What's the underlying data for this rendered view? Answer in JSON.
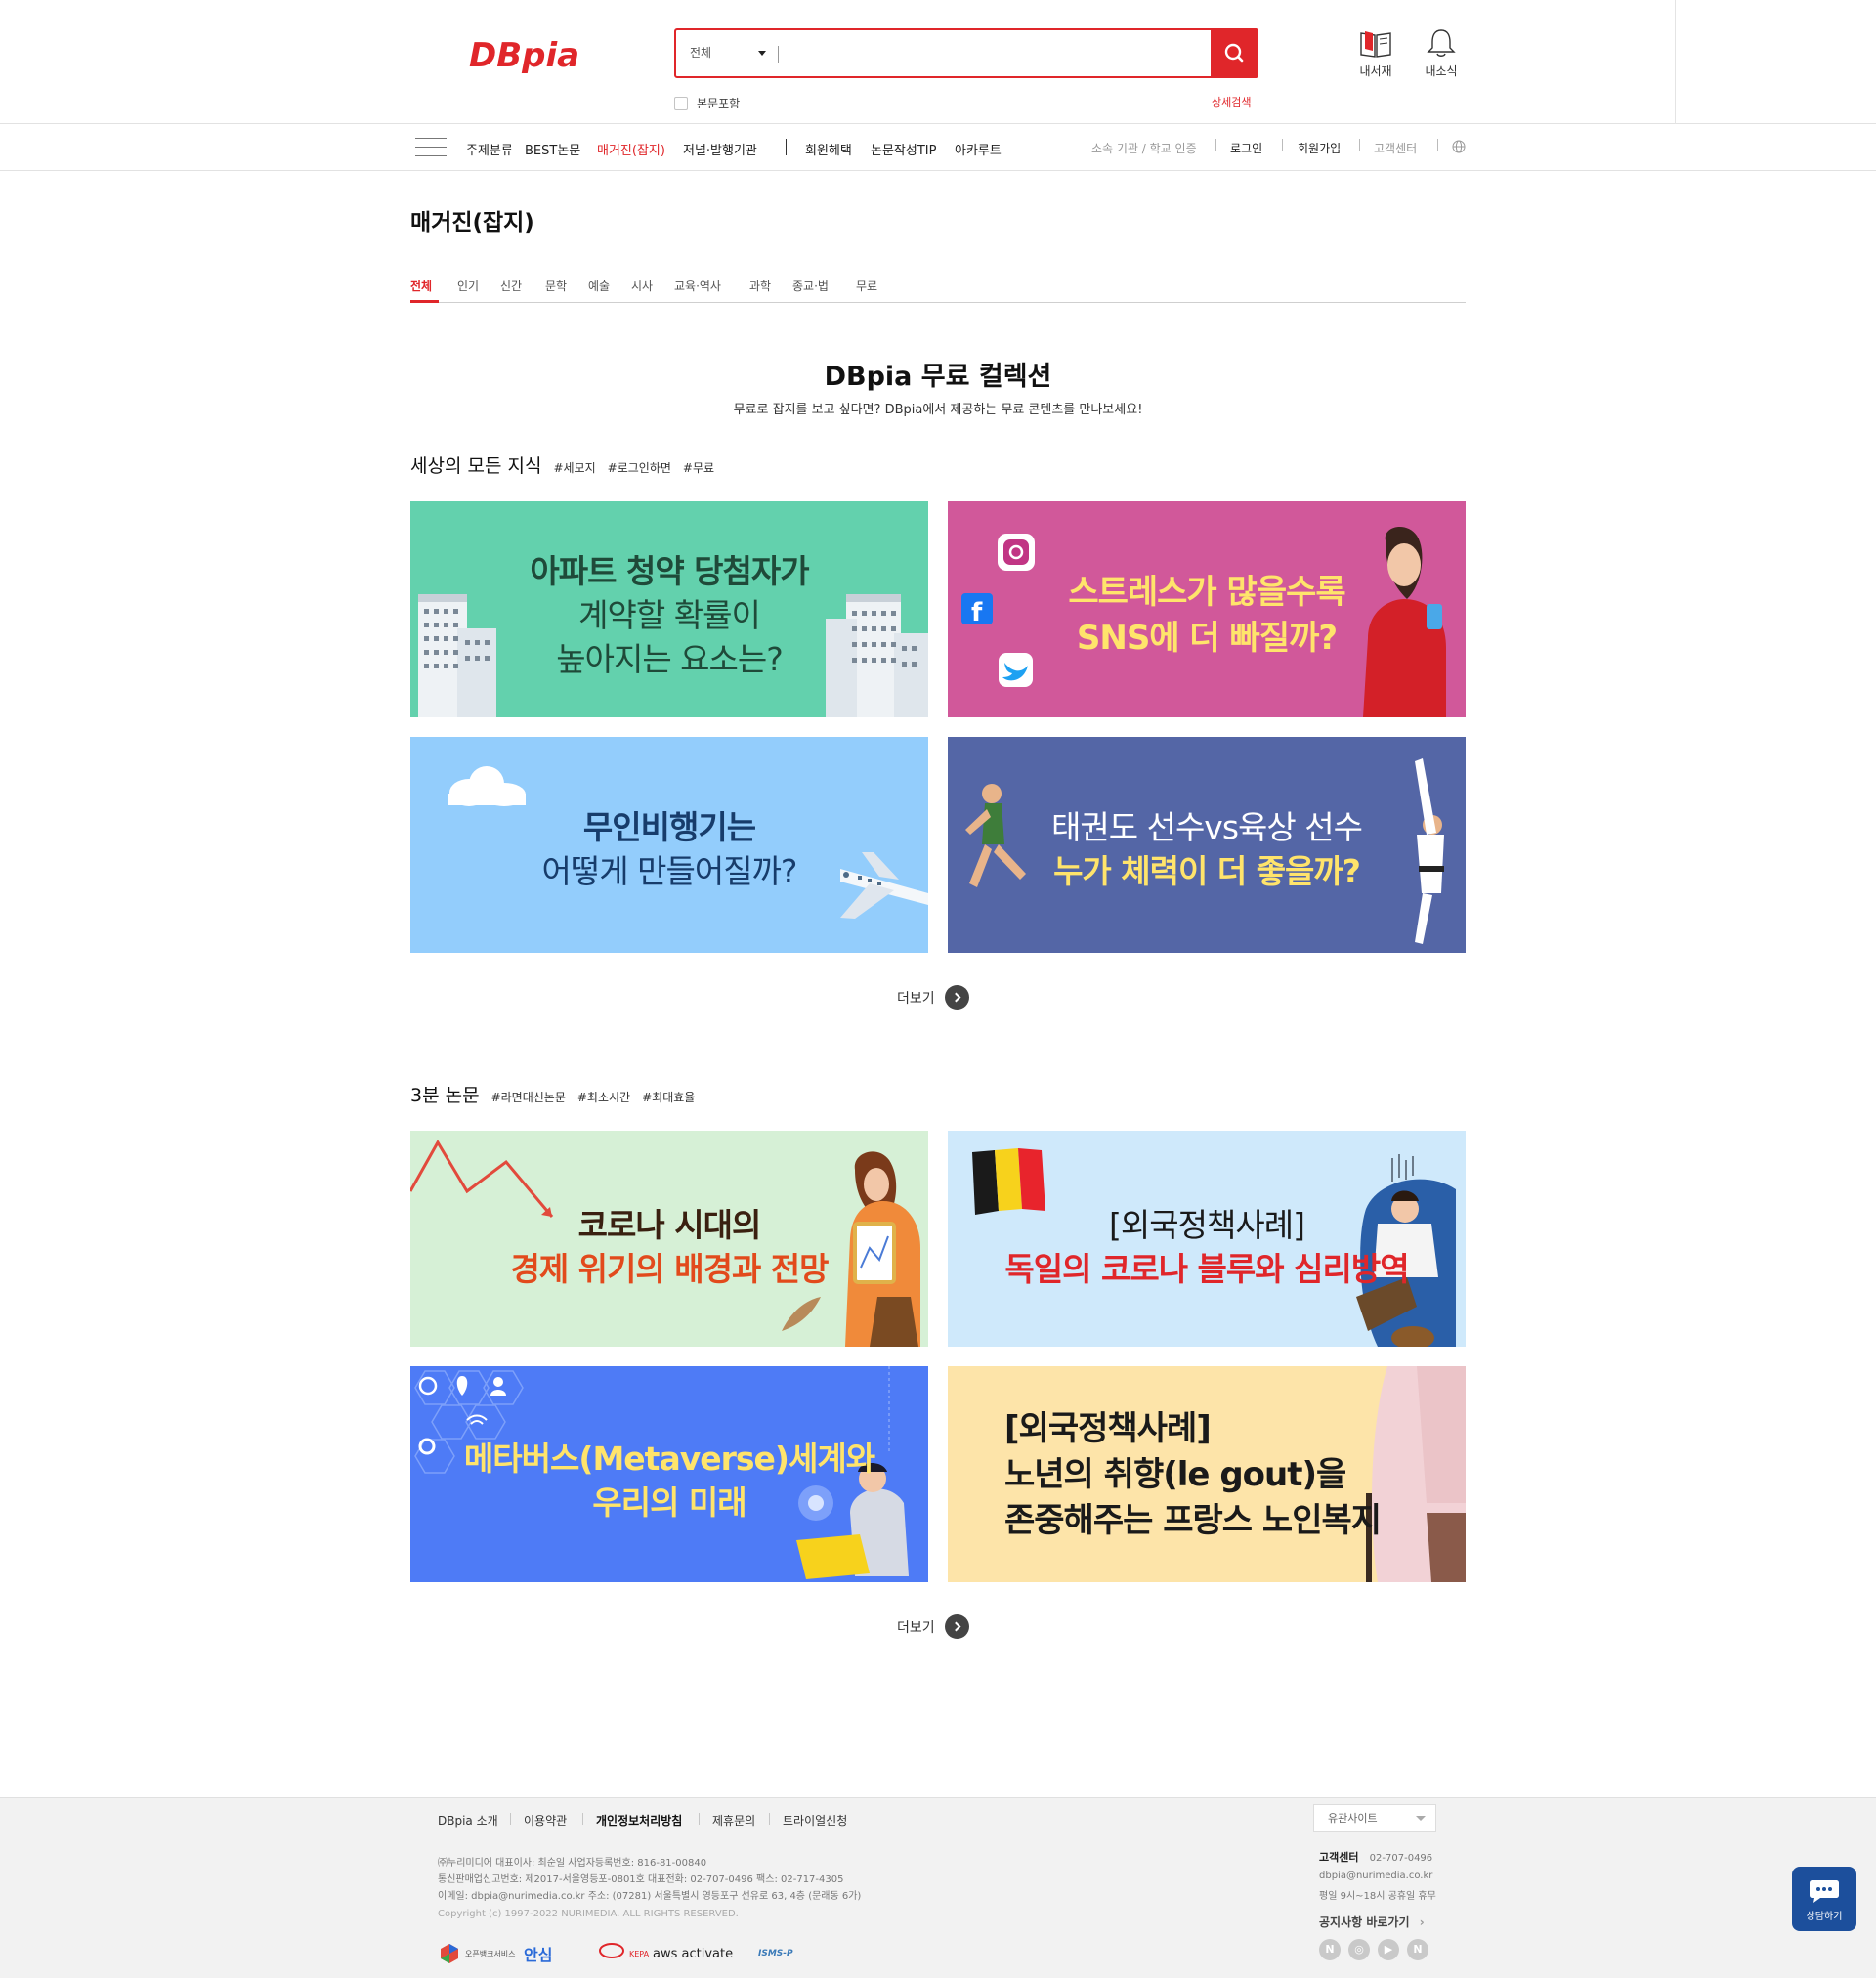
{
  "brand": {
    "logo_text": "DBpia",
    "accent_color": "#e0262a"
  },
  "search": {
    "scope_selected": "전체",
    "placeholder": "",
    "fulltext_label": "본문포함",
    "advanced_label": "상세검색"
  },
  "header_icons": {
    "mylib_label": "내서재",
    "mynews_label": "내소식"
  },
  "gnb": {
    "items": [
      "주제분류",
      "BEST논문",
      "매거진(잡지)",
      "저널·발행기관",
      "회원혜택",
      "논문작성TIP",
      "아카루트"
    ],
    "active_index": 2,
    "util": [
      "소속 기관 / 학교 인증",
      "로그인",
      "회원가입",
      "고객센터"
    ]
  },
  "page": {
    "title": "매거진(잡지)",
    "tabs": [
      "전체",
      "인기",
      "신간",
      "문학",
      "예술",
      "시사",
      "교육·역사",
      "과학",
      "종교·법",
      "무료"
    ],
    "active_tab": 0
  },
  "collection": {
    "title": "DBpia 무료 컬렉션",
    "subtitle": "무료로 잡지를 보고 싶다면? DBpia에서 제공하는 무료 콘텐츠를 만나보세요!"
  },
  "sections": [
    {
      "title": "세상의 모든 지식",
      "tags": [
        "#세모지",
        "#로그인하면",
        "#무료"
      ],
      "more_label": "더보기",
      "banners": [
        {
          "lines": [
            "아파트 청약 당첨자가",
            "계약할 확률이",
            "높아지는 요소는?"
          ],
          "bg": "#63d1ad"
        },
        {
          "lines": [
            "스트레스가 많을수록",
            "SNS에 더 빠질까?"
          ],
          "bg": "#d1589a"
        },
        {
          "lines": [
            "무인비행기는",
            "어떻게 만들어질까?"
          ],
          "bg": "#93cdfc"
        },
        {
          "lines": [
            "태권도 선수vs육상 선수",
            "누가 체력이 더 좋을까?"
          ],
          "bg": "#5466a6"
        }
      ]
    },
    {
      "title": "3분 논문",
      "tags": [
        "#라면대신논문",
        "#최소시간",
        "#최대효율"
      ],
      "more_label": "더보기",
      "banners": [
        {
          "lines": [
            "코로나 시대의",
            "경제 위기의 배경과 전망"
          ],
          "bg": "#d6f0d6"
        },
        {
          "lines": [
            "[외국정책사례]",
            "독일의 코로나 블루와 심리방역"
          ],
          "bg": "#cfe9fb"
        },
        {
          "lines": [
            "메타버스(Metaverse)세계와",
            "우리의 미래"
          ],
          "bg": "#4e7bf6"
        },
        {
          "lines": [
            "[외국정책사례]",
            "노년의 취향(le gout)을",
            "존중해주는 프랑스 노인복지"
          ],
          "bg": "#fde4a9"
        }
      ]
    }
  ],
  "footer": {
    "links": [
      "DBpia 소개",
      "이용약관",
      "개인정보처리방침",
      "제휴문의",
      "트라이얼신청"
    ],
    "family_site": "유관사이트",
    "company_lines": [
      "㈜누리미디어 대표이사: 최순일 사업자등록번호: 816-81-00840",
      "통신판매업신고번호: 제2017-서울영등포-0801호  대표전화: 02-707-0496 팩스: 02-717-4305",
      "이메일: dbpia@nurimedia.co.kr 주소: (07281) 서울특별시 영등포구 선유로 63, 4층 (문래동 6가)"
    ],
    "copyright": "Copyright (c) 1997-2022 NURIMEDIA. ALL RIGHTS RESERVED.",
    "cs_title": "고객센터",
    "cs_phone": "02-707-0496",
    "cs_email": "dbpia@nurimedia.co.kr",
    "cs_hours": "평일 9시~18시 공휴일 휴무",
    "notice_label": "공지사항 바로가기",
    "certs": [
      "오픈뱅크서비스",
      "안심",
      "KEPA",
      "aws activate",
      "ISMS-P"
    ],
    "chat_label": "상담하기"
  }
}
